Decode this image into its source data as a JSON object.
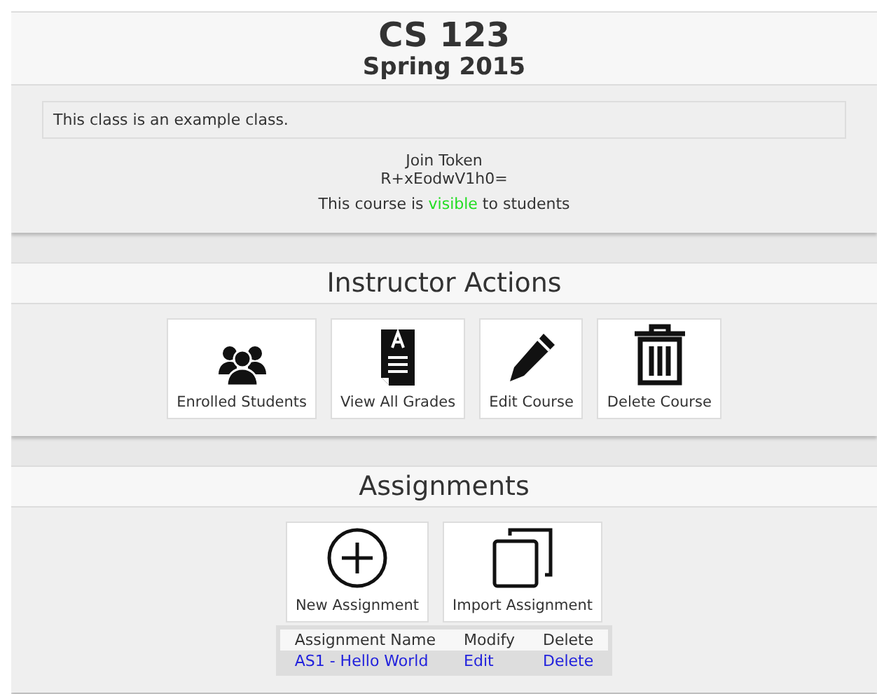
{
  "course": {
    "code": "CS 123",
    "term": "Spring 2015"
  },
  "description": "This class is an example class.",
  "join_token": {
    "label": "Join Token",
    "value": "R+xEodwV1h0="
  },
  "visibility_note": "This course is **visible** to students",
  "instructor_actions": {
    "title": "Instructor Actions",
    "buttons": [
      {
        "kind": "students",
        "label": "Enrolled Students"
      },
      {
        "kind": "grades",
        "label": "View All Grades"
      },
      {
        "kind": "edit",
        "label": "Edit Course"
      },
      {
        "kind": "delete",
        "label": "Delete Course"
      }
    ]
  },
  "assignments": {
    "title": "Assignments",
    "buttons": [
      {
        "kind": "new",
        "label": "New Assignment"
      },
      {
        "kind": "import",
        "label": "Import Assignment"
      }
    ],
    "table": {
      "columns": [
        "Assignment Name",
        "Modify",
        "Delete"
      ],
      "rows": [
        {
          "name": "AS1 - Hello World",
          "modify": "Edit",
          "delete": "Delete"
        }
      ]
    }
  }
}
